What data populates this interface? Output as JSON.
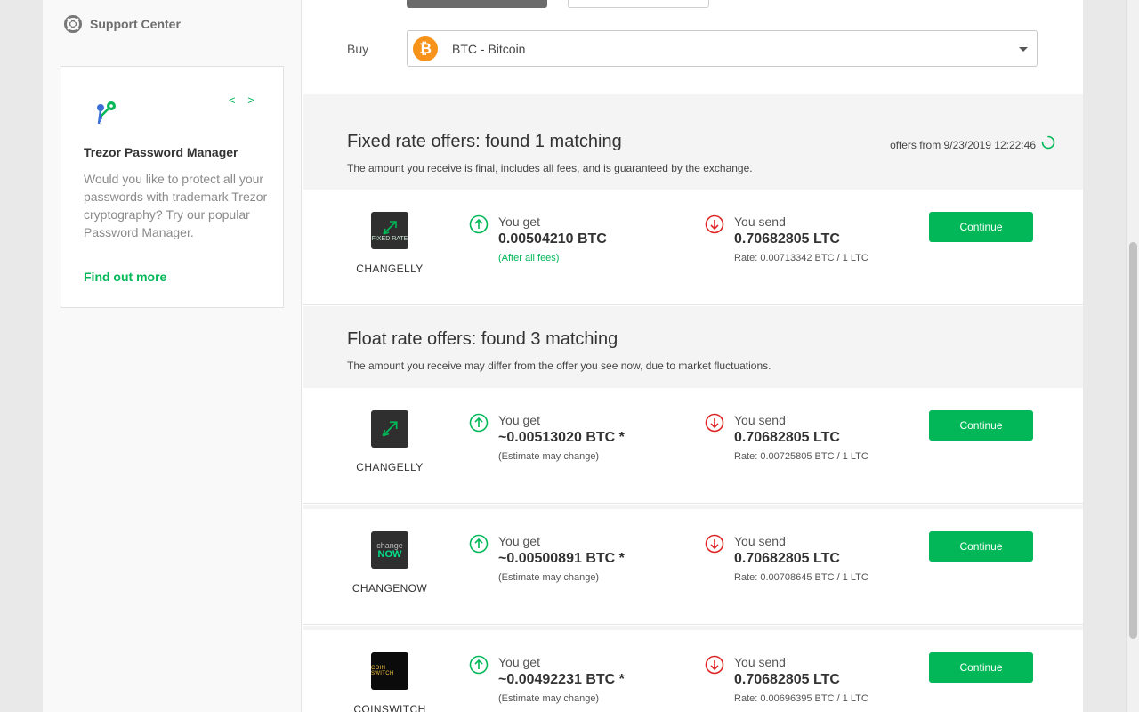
{
  "sidebar": {
    "support_label": "Support Center",
    "promo": {
      "prev": "<",
      "next": ">",
      "title": "Trezor Password Manager",
      "text": "Would you like to protect all your passwords with trademark Trezor cryptography? Try our popular Password Manager.",
      "link": "Find out more"
    }
  },
  "buy": {
    "label": "Buy",
    "selected": "BTC - Bitcoin",
    "coin_glyph": "₿"
  },
  "fixed": {
    "title": "Fixed rate offers: found 1 matching",
    "subtitle": "The amount you receive is final, includes all fees, and is guaranteed by the exchange.",
    "offers_from": "offers from 9/23/2019 12:22:46",
    "offers": [
      {
        "exchange": "CHANGELLY",
        "logo_sub": "FIXED RATE",
        "get_label": "You get",
        "get_amount": "0.00504210 BTC",
        "get_note": "(After all fees)",
        "send_label": "You send",
        "send_amount": "0.70682805 LTC",
        "rate": "Rate: 0.00713342 BTC / 1 LTC",
        "button": "Continue"
      }
    ]
  },
  "float": {
    "title": "Float rate offers: found 3 matching",
    "subtitle": "The amount you receive may differ from the offer you see now, due to market fluctuations.",
    "offers": [
      {
        "exchange": "CHANGELLY",
        "get_label": "You get",
        "get_amount": "~0.00513020 BTC *",
        "get_note": "(Estimate may change)",
        "send_label": "You send",
        "send_amount": "0.70682805 LTC",
        "rate": "Rate: 0.00725805 BTC / 1 LTC",
        "button": "Continue"
      },
      {
        "exchange": "CHANGENOW",
        "logo_top": "change",
        "logo_bottom": "NOW",
        "get_label": "You get",
        "get_amount": "~0.00500891 BTC *",
        "get_note": "(Estimate may change)",
        "send_label": "You send",
        "send_amount": "0.70682805 LTC",
        "rate": "Rate: 0.00708645 BTC / 1 LTC",
        "button": "Continue"
      },
      {
        "exchange": "COINSWITCH",
        "logo_text": "COIN SWITCH",
        "get_label": "You get",
        "get_amount": "~0.00492231 BTC *",
        "get_note": "(Estimate may change)",
        "send_label": "You send",
        "send_amount": "0.70682805 LTC",
        "rate": "Rate: 0.00696395 BTC / 1 LTC",
        "button": "Continue"
      }
    ]
  },
  "colors": {
    "accent": "#01b757",
    "send": "#e02424",
    "bitcoin": "#f7931a"
  }
}
